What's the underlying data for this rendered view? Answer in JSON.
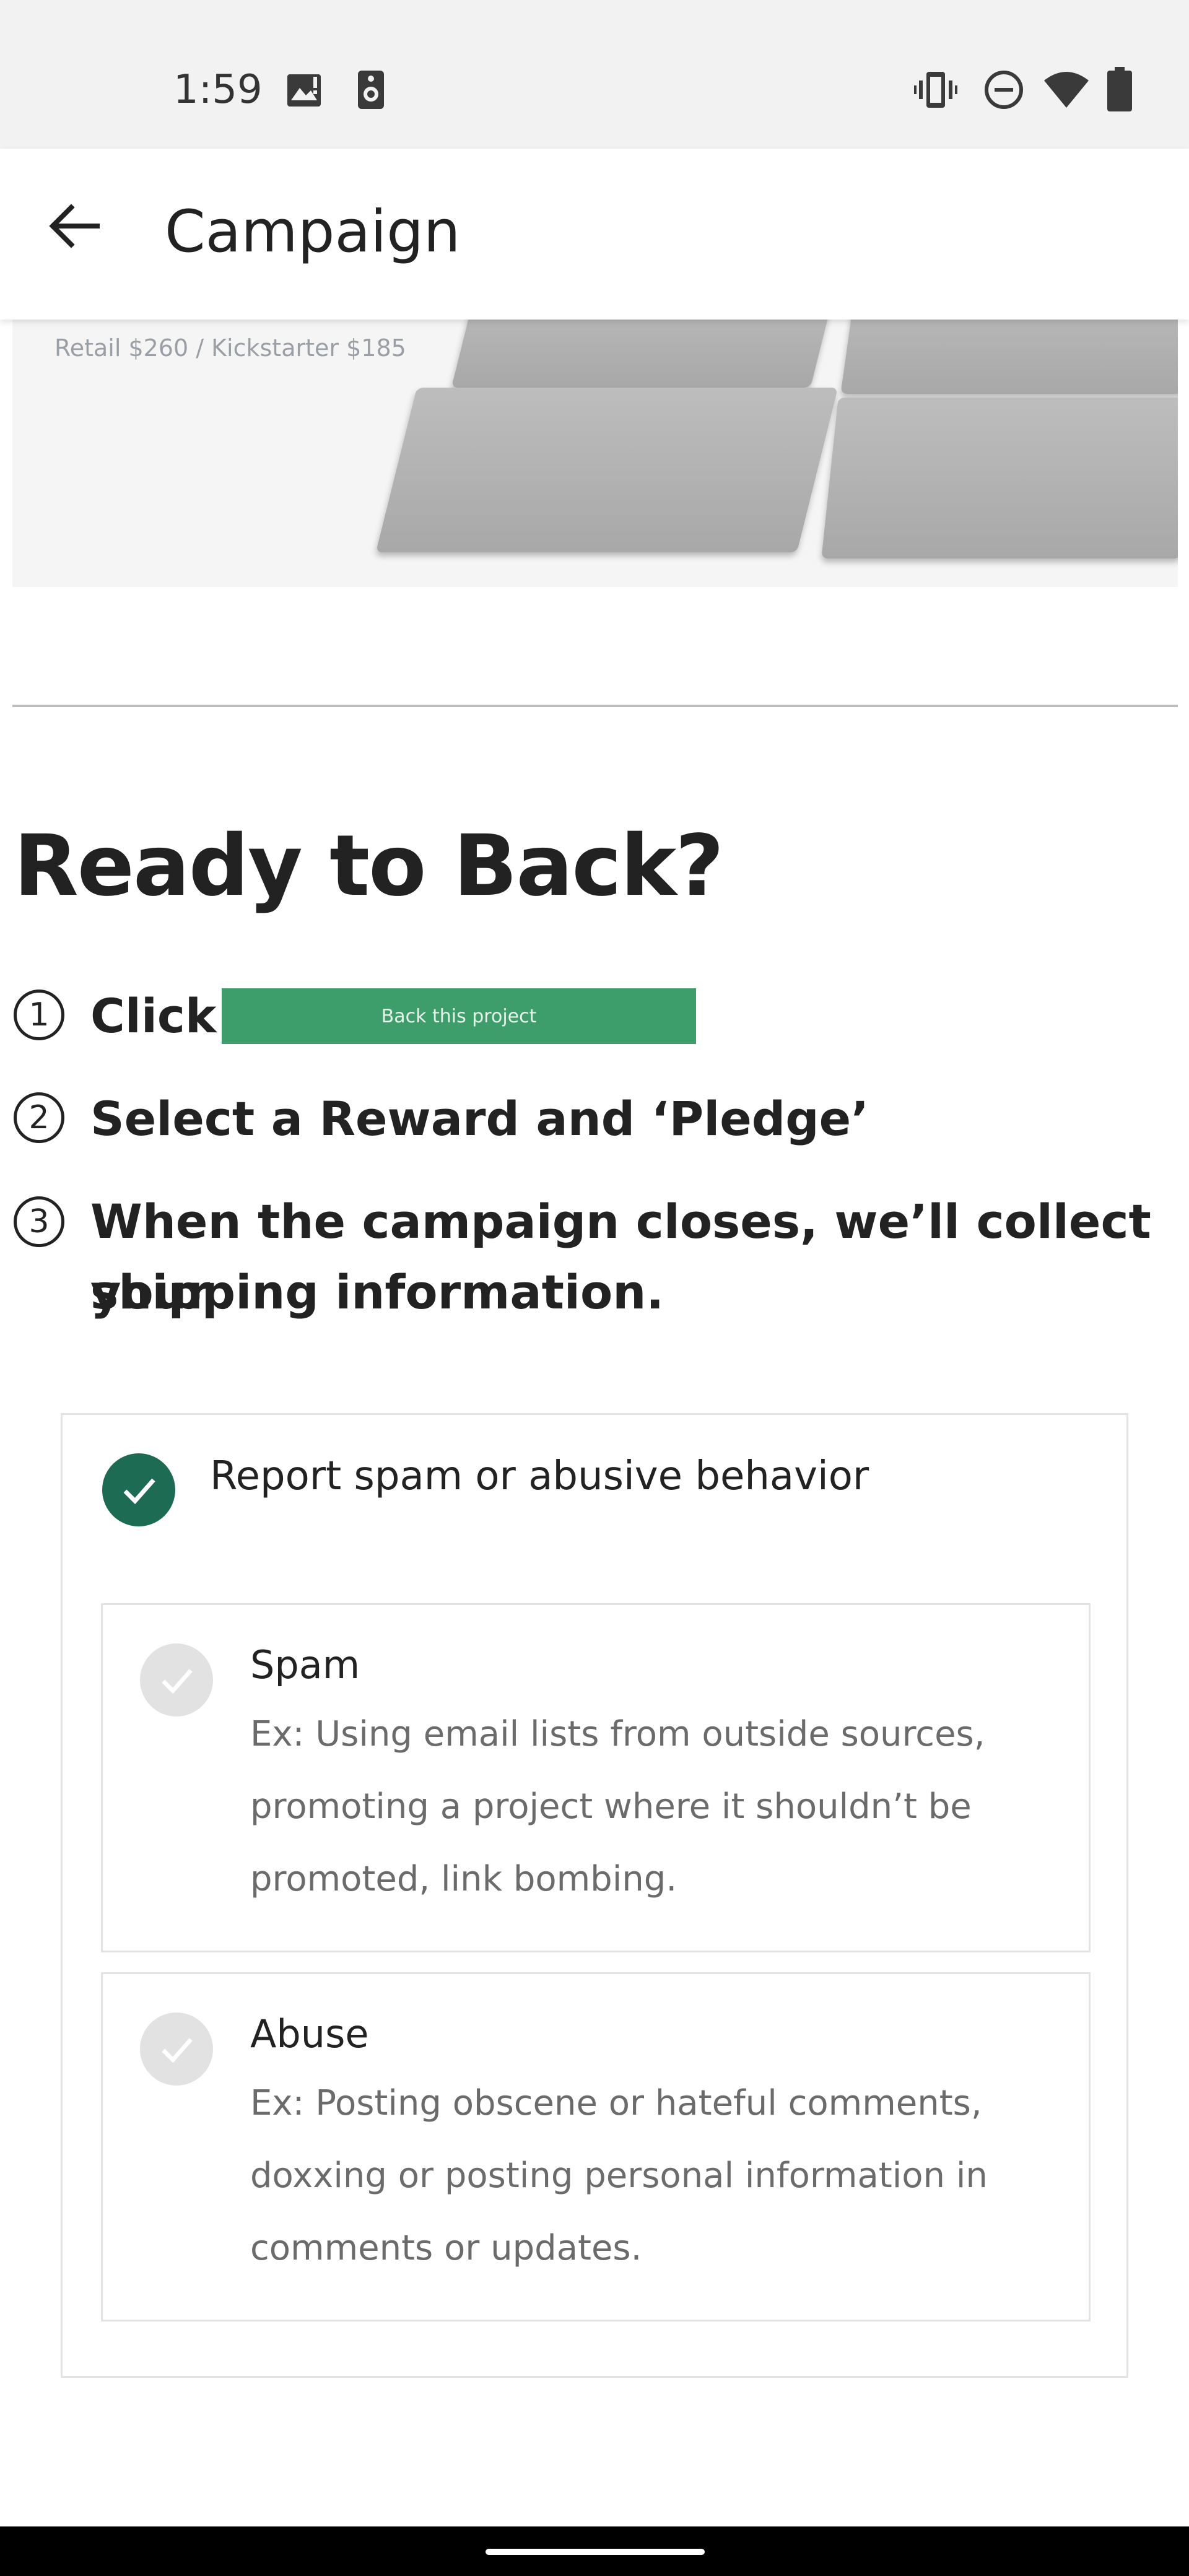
{
  "status_bar": {
    "time": "1:59",
    "left_icons": [
      "image-icon",
      "speaker-icon"
    ],
    "right_icons": [
      "vibrate-icon",
      "do-not-disturb-icon",
      "wifi-icon",
      "battery-icon"
    ]
  },
  "app_bar": {
    "title": "Campaign",
    "back_icon": "arrow-back-icon"
  },
  "content": {
    "hero_caption": "Retail $260 /  Kickstarter $185",
    "heading": "Ready to Back?",
    "steps": [
      {
        "number": "1",
        "text": "Click"
      },
      {
        "number": "2",
        "text": "Select a Reward and ‘Pledge’"
      },
      {
        "number": "3",
        "line1": "When the campaign closes, we’ll collect your",
        "line2": "shipping information."
      }
    ],
    "back_button_label": "Back this project"
  },
  "report": {
    "title": "Report spam or abusive behavior",
    "accent_color": "#1e6b54",
    "options": [
      {
        "title": "Spam",
        "desc_lines": [
          "Ex: Using email lists from outside sources,",
          "promoting a project where it shouldn’t be",
          "promoted, link bombing."
        ]
      },
      {
        "title": "Abuse",
        "desc_lines": [
          "Ex: Posting obscene or hateful comments,",
          "doxxing or posting personal information in",
          "comments or updates."
        ]
      }
    ]
  }
}
